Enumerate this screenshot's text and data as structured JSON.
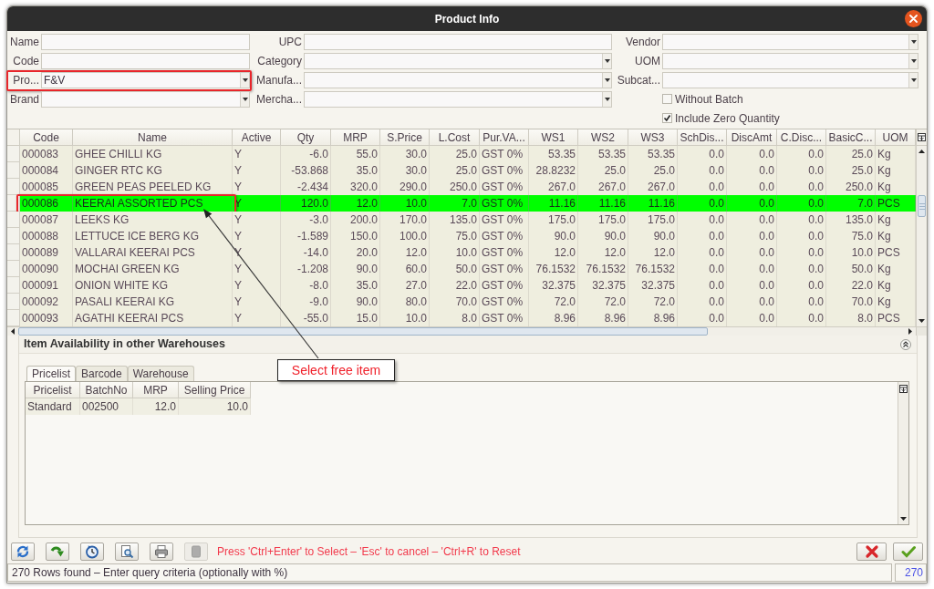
{
  "window": {
    "title": "Product Info"
  },
  "filters": [
    {
      "label": "Name",
      "kind": "text",
      "annotated": false
    },
    {
      "label": "UPC",
      "kind": "text",
      "annotated": false
    },
    {
      "label": "Vendor",
      "kind": "dropdown",
      "annotated": false
    },
    {
      "label": "Code",
      "kind": "text",
      "annotated": false
    },
    {
      "label": "Category",
      "kind": "dropdown",
      "annotated": false
    },
    {
      "label": "UOM",
      "kind": "dropdown",
      "annotated": false
    },
    {
      "label": "Pro...",
      "kind": "dropdown",
      "value": "F&V",
      "annotated": true
    },
    {
      "label": "Manufa...",
      "kind": "dropdown",
      "annotated": false
    },
    {
      "label": "Subcat...",
      "kind": "dropdown",
      "annotated": false
    },
    {
      "label": "Brand",
      "kind": "dropdown",
      "annotated": false
    },
    {
      "label": "Mercha...",
      "kind": "dropdown",
      "annotated": false
    }
  ],
  "options": [
    {
      "label": "Without Batch",
      "checked": false
    },
    {
      "label": "Include Zero Quantity",
      "checked": true
    }
  ],
  "table": {
    "columns": [
      "Code",
      "Name",
      "Active",
      "Qty",
      "MRP",
      "S.Price",
      "L.Cost",
      "Pur.VA...",
      "WS1",
      "WS2",
      "WS3",
      "SchDis...",
      "DiscAmt",
      "C.Disc...",
      "BasicC...",
      "UOM"
    ],
    "rows": [
      {
        "selected": false,
        "annotated": false,
        "cells": [
          "000083",
          "GHEE CHILLI KG",
          "Y",
          "-6.0",
          "55.0",
          "30.0",
          "25.0",
          "GST 0%",
          "53.35",
          "53.35",
          "53.35",
          "0.0",
          "0.0",
          "0.0",
          "25.0",
          "Kg"
        ]
      },
      {
        "selected": false,
        "annotated": false,
        "cells": [
          "000084",
          "GINGER RTC KG",
          "Y",
          "-53.868",
          "35.0",
          "30.0",
          "25.0",
          "GST 0%",
          "28.8232",
          "25.0",
          "25.0",
          "0.0",
          "0.0",
          "0.0",
          "25.0",
          "Kg"
        ]
      },
      {
        "selected": false,
        "annotated": false,
        "cells": [
          "000085",
          "GREEN PEAS PEELED KG",
          "Y",
          "-2.434",
          "320.0",
          "290.0",
          "250.0",
          "GST 0%",
          "267.0",
          "267.0",
          "267.0",
          "0.0",
          "0.0",
          "0.0",
          "250.0",
          "Kg"
        ]
      },
      {
        "selected": true,
        "annotated": true,
        "cells": [
          "000086",
          "KEERAI ASSORTED PCS",
          "Y",
          "120.0",
          "12.0",
          "10.0",
          "7.0",
          "GST 0%",
          "11.16",
          "11.16",
          "11.16",
          "0.0",
          "0.0",
          "0.0",
          "7.0",
          "PCS"
        ]
      },
      {
        "selected": false,
        "annotated": false,
        "cells": [
          "000087",
          "LEEKS KG",
          "Y",
          "-3.0",
          "200.0",
          "170.0",
          "135.0",
          "GST 0%",
          "175.0",
          "175.0",
          "175.0",
          "0.0",
          "0.0",
          "0.0",
          "135.0",
          "Kg"
        ]
      },
      {
        "selected": false,
        "annotated": false,
        "cells": [
          "000088",
          "LETTUCE ICE BERG KG",
          "Y",
          "-1.589",
          "150.0",
          "100.0",
          "75.0",
          "GST 0%",
          "90.0",
          "90.0",
          "90.0",
          "0.0",
          "0.0",
          "0.0",
          "75.0",
          "Kg"
        ]
      },
      {
        "selected": false,
        "annotated": false,
        "cells": [
          "000089",
          "VALLARAI KEERAI PCS",
          "Y",
          "-14.0",
          "20.0",
          "12.0",
          "10.0",
          "GST 0%",
          "12.0",
          "12.0",
          "12.0",
          "0.0",
          "0.0",
          "0.0",
          "10.0",
          "PCS"
        ]
      },
      {
        "selected": false,
        "annotated": false,
        "cells": [
          "000090",
          "MOCHAI GREEN KG",
          "Y",
          "-1.208",
          "90.0",
          "60.0",
          "50.0",
          "GST 0%",
          "76.1532",
          "76.1532",
          "76.1532",
          "0.0",
          "0.0",
          "0.0",
          "50.0",
          "Kg"
        ]
      },
      {
        "selected": false,
        "annotated": false,
        "cells": [
          "000091",
          "ONION WHITE KG",
          "Y",
          "-8.0",
          "35.0",
          "27.0",
          "22.0",
          "GST 0%",
          "32.375",
          "32.375",
          "32.375",
          "0.0",
          "0.0",
          "0.0",
          "22.0",
          "Kg"
        ]
      },
      {
        "selected": false,
        "annotated": false,
        "cells": [
          "000092",
          "PASALI KEERAI KG",
          "Y",
          "-9.0",
          "90.0",
          "80.0",
          "70.0",
          "GST 0%",
          "72.0",
          "72.0",
          "72.0",
          "0.0",
          "0.0",
          "0.0",
          "70.0",
          "Kg"
        ]
      },
      {
        "selected": false,
        "annotated": false,
        "cells": [
          "000093",
          "AGATHI KEERAI PCS",
          "Y",
          "-55.0",
          "15.0",
          "10.0",
          "8.0",
          "GST 0%",
          "8.96",
          "8.96",
          "8.96",
          "0.0",
          "0.0",
          "0.0",
          "8.0",
          "PCS"
        ]
      }
    ]
  },
  "callout": {
    "text": "Select free item"
  },
  "availability": {
    "title": "Item Availability in other Warehouses",
    "tabs": [
      {
        "label": "Pricelist",
        "selected": true
      },
      {
        "label": "Barcode",
        "selected": false
      },
      {
        "label": "Warehouse",
        "selected": false
      }
    ],
    "table": {
      "columns": [
        "Pricelist",
        "BatchNo",
        "MRP",
        "Selling Price"
      ],
      "rows": [
        {
          "cells": [
            "Standard",
            "002500",
            "12.0",
            "10.0"
          ]
        }
      ]
    }
  },
  "toolbar": [
    {
      "kind": "refresh",
      "disabled": false
    },
    {
      "kind": "forward",
      "disabled": false
    },
    {
      "kind": "history",
      "disabled": false
    },
    {
      "kind": "preview",
      "disabled": false
    },
    {
      "kind": "print",
      "disabled": false
    },
    {
      "kind": "document",
      "disabled": true
    }
  ],
  "hint": "Press 'Ctrl+Enter' to Select – 'Esc' to cancel – 'Ctrl+R' to Reset",
  "dialog_buttons": [
    {
      "kind": "cancel"
    },
    {
      "kind": "ok"
    }
  ],
  "status_bar": {
    "message": "270 Rows found – Enter query criteria (optionally with %)",
    "count": "270"
  }
}
